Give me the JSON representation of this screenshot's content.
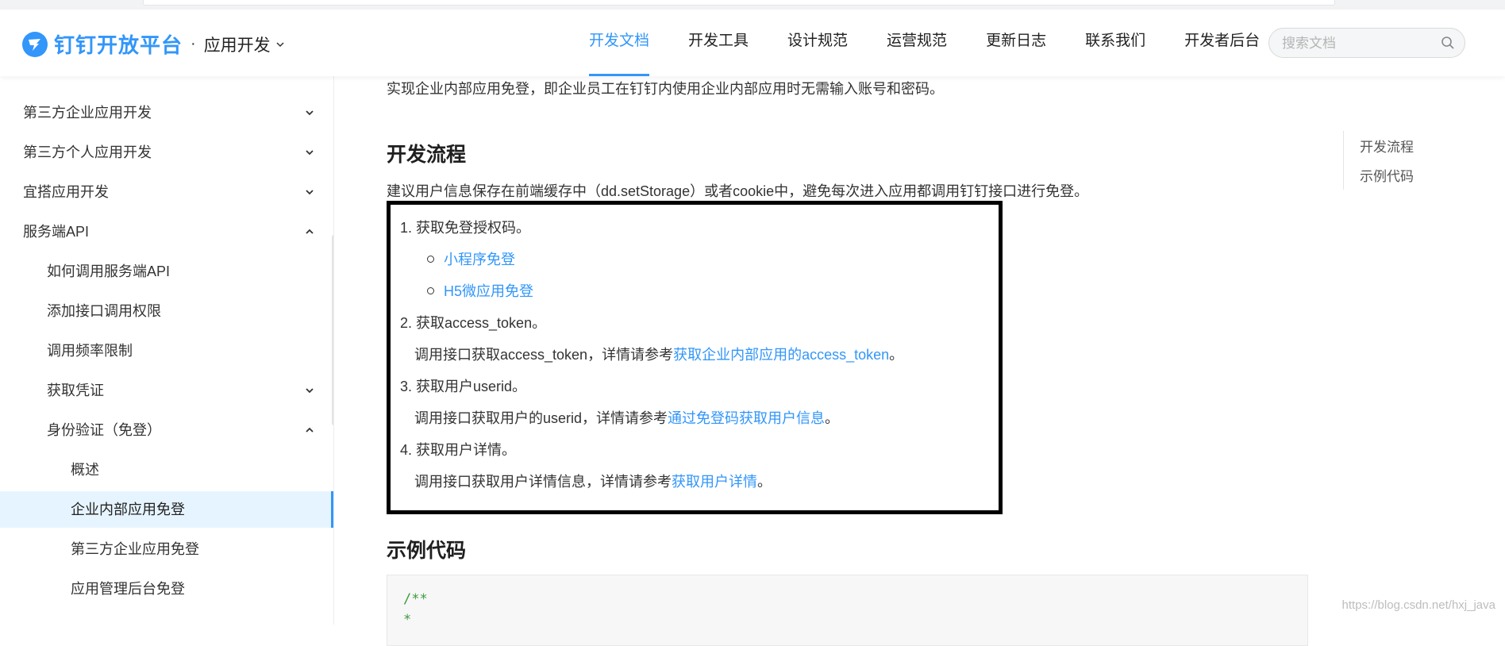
{
  "header": {
    "logo_text": "钉钉开放平台",
    "separator": "·",
    "app_dev": "应用开发",
    "nav": [
      "开发文档",
      "开发工具",
      "设计规范",
      "运营规范",
      "更新日志",
      "联系我们",
      "开发者后台"
    ],
    "active_nav": "开发文档",
    "search_placeholder": "搜索文档",
    "accent_color": "#3296fa"
  },
  "sidebar": {
    "items": [
      {
        "label": "第三方企业应用开发",
        "level": 1,
        "arrow": "down"
      },
      {
        "label": "第三方个人应用开发",
        "level": 1,
        "arrow": "down"
      },
      {
        "label": "宜搭应用开发",
        "level": 1,
        "arrow": "down"
      },
      {
        "label": "服务端API",
        "level": 1,
        "arrow": "up"
      },
      {
        "label": "如何调用服务端API",
        "level": 2,
        "arrow": ""
      },
      {
        "label": "添加接口调用权限",
        "level": 2,
        "arrow": ""
      },
      {
        "label": "调用频率限制",
        "level": 2,
        "arrow": ""
      },
      {
        "label": "获取凭证",
        "level": 2,
        "arrow": "down"
      },
      {
        "label": "身份验证（免登）",
        "level": 2,
        "arrow": "up"
      },
      {
        "label": "概述",
        "level": 3,
        "arrow": ""
      },
      {
        "label": "企业内部应用免登",
        "level": 3,
        "arrow": "",
        "active": true
      },
      {
        "label": "第三方企业应用免登",
        "level": 3,
        "arrow": ""
      },
      {
        "label": "应用管理后台免登",
        "level": 3,
        "arrow": ""
      }
    ]
  },
  "content": {
    "intro": "实现企业内部应用免登，即企业员工在钉钉内使用企业内部应用时无需输入账号和密码。",
    "section1_title": "开发流程",
    "section1_desc": "建议用户信息保存在前端缓存中（dd.setStorage）或者cookie中，避免每次进入应用都调用钉钉接口进行免登。",
    "steps": {
      "s1": "1. 获取免登授权码。",
      "s1_sub1": "小程序免登",
      "s1_sub2": "H5微应用免登",
      "s2": "2. 获取access_token。",
      "s2_desc": "调用接口获取access_token，详情请参考",
      "s2_link": "获取企业内部应用的access_token",
      "s3": "3. 获取用户userid。",
      "s3_desc": "调用接口获取用户的userid，详情请参考",
      "s3_link": "通过免登码获取用户信息",
      "s4": "4. 获取用户详情。",
      "s4_desc": "调用接口获取用户详情信息，详情请参考",
      "s4_link": "获取用户详情",
      "period": "。"
    },
    "section2_title": "示例代码",
    "code_lines": [
      "/**",
      " *"
    ]
  },
  "toc": [
    "开发流程",
    "示例代码"
  ],
  "watermark": "https://blog.csdn.net/hxj_java"
}
